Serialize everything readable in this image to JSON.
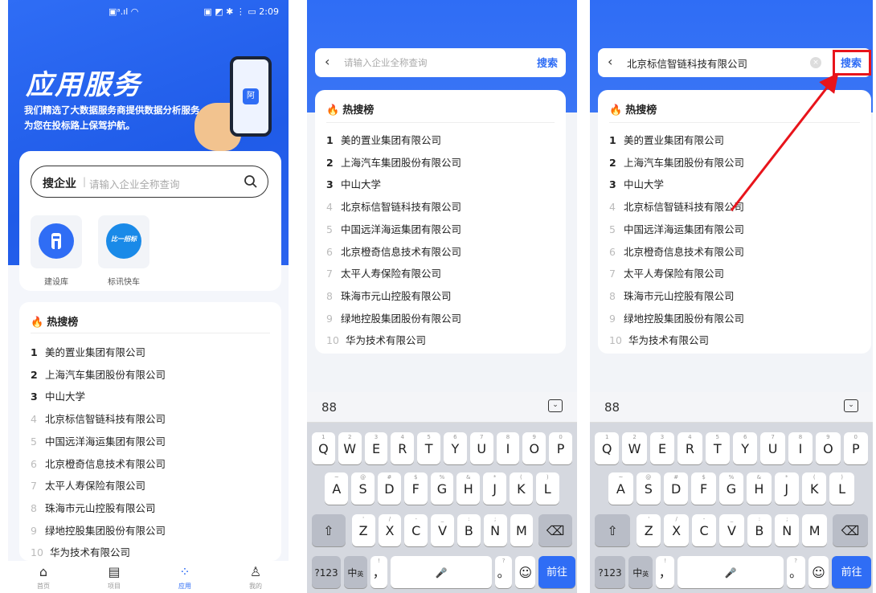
{
  "panel1": {
    "statusbar": {
      "mid": "▣ᵃ.ıl ◠",
      "right": "▣ ◩ ✱ ⋮ ▭ 2:09"
    },
    "hero": {
      "title": "应用服务",
      "desc_line1": "我们精选了大数据服务商提供数据分析服务",
      "desc_line2": "为您在投标路上保驾护航。",
      "phone_icon": "阿"
    },
    "search": {
      "label": "搜企业",
      "placeholder": "请输入企业全称查询"
    },
    "apps": [
      {
        "label": "建设库",
        "color": "#2f6df5"
      },
      {
        "label": "标讯快车",
        "color": "#1a8ae8",
        "badge": "比一招标"
      }
    ],
    "hot_title": "热搜榜",
    "nav": [
      {
        "label": "首页",
        "icon": "home-icon"
      },
      {
        "label": "项目",
        "icon": "calendar-icon"
      },
      {
        "label": "应用",
        "icon": "apps-icon"
      },
      {
        "label": "我的",
        "icon": "user-icon"
      }
    ]
  },
  "panel2": {
    "search_placeholder": "请输入企业全称查询",
    "search_button": "搜索",
    "hot_title": "热搜榜"
  },
  "panel3": {
    "search_value": "北京标信智链科技有限公司",
    "search_button": "搜索",
    "hot_title": "热搜榜"
  },
  "hot_list": [
    {
      "rank": "1",
      "name": "美的置业集团有限公司"
    },
    {
      "rank": "2",
      "name": "上海汽车集团股份有限公司"
    },
    {
      "rank": "3",
      "name": "中山大学"
    },
    {
      "rank": "4",
      "name": "北京标信智链科技有限公司"
    },
    {
      "rank": "5",
      "name": "中国远洋海运集团有限公司"
    },
    {
      "rank": "6",
      "name": "北京橙奇信息技术有限公司"
    },
    {
      "rank": "7",
      "name": "太平人寿保险有限公司"
    },
    {
      "rank": "8",
      "name": "珠海市元山控股有限公司"
    },
    {
      "rank": "9",
      "name": "绿地控股集团股份有限公司"
    },
    {
      "rank": "10",
      "name": "华为技术有限公司"
    }
  ],
  "keyboard": {
    "row1": [
      {
        "k": "Q",
        "s": "1"
      },
      {
        "k": "W",
        "s": "2"
      },
      {
        "k": "E",
        "s": "3"
      },
      {
        "k": "R",
        "s": "4"
      },
      {
        "k": "T",
        "s": "5"
      },
      {
        "k": "Y",
        "s": "6"
      },
      {
        "k": "U",
        "s": "7"
      },
      {
        "k": "I",
        "s": "8"
      },
      {
        "k": "O",
        "s": "9"
      },
      {
        "k": "P",
        "s": "0"
      }
    ],
    "row2": [
      {
        "k": "A",
        "s": "~"
      },
      {
        "k": "S",
        "s": "@"
      },
      {
        "k": "D",
        "s": "#"
      },
      {
        "k": "F",
        "s": "$"
      },
      {
        "k": "G",
        "s": "%"
      },
      {
        "k": "H",
        "s": "&"
      },
      {
        "k": "J",
        "s": "*"
      },
      {
        "k": "K",
        "s": "("
      },
      {
        "k": "L",
        "s": ")"
      }
    ],
    "row3": [
      {
        "k": "Z",
        "s": "'"
      },
      {
        "k": "X",
        "s": "/"
      },
      {
        "k": "C",
        "s": "-"
      },
      {
        "k": "V",
        "s": "_"
      },
      {
        "k": "B",
        "s": ":"
      },
      {
        "k": "N",
        "s": ";"
      },
      {
        "k": "M",
        "s": ""
      }
    ],
    "shift": "⇧",
    "backspace": "⌫",
    "num": "?123",
    "lang": "中",
    "lang_sub": "英",
    "comma": "，",
    "comma_sup": "!",
    "space": "🎤",
    "period": "。",
    "period_sup": "?",
    "emoji": "☺",
    "enter": "前往",
    "toolbar_left": "88",
    "toolbar_right": "⌄"
  },
  "colors": {
    "brand": "#2f6df5",
    "highlight": "#e8141b",
    "fire": "#f04a2a"
  }
}
